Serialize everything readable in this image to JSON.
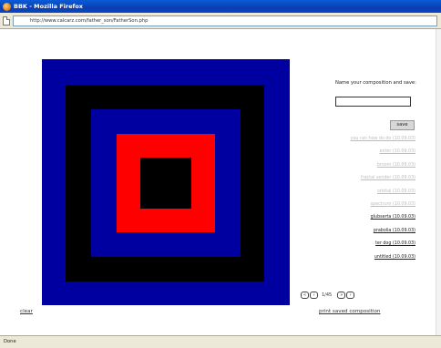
{
  "window": {
    "title": "BBK - Mozilla Firefox"
  },
  "address": {
    "url": "http://www.calcarz.com/father_son/FatherSon.php"
  },
  "side": {
    "name_label": "Name your composition and save:",
    "name_value": "",
    "save_label": "save",
    "compositions": [
      {
        "label": "you ran how do do (10.09.03)",
        "state": "faded"
      },
      {
        "label": "enter (10.09.03)",
        "state": "faded"
      },
      {
        "label": "broom (10.09.03)",
        "state": "faded"
      },
      {
        "label": "fractal sender (10.09.03)",
        "state": "faded"
      },
      {
        "label": "orbital (10.09.03)",
        "state": "faded"
      },
      {
        "label": "spectrum (10.09.03)",
        "state": "faded"
      },
      {
        "label": "glubserta (10.09.03)",
        "state": "active"
      },
      {
        "label": "prabolia (10.09.03)",
        "state": "active"
      },
      {
        "label": "ter dog (10.09.03)",
        "state": "active"
      },
      {
        "label": "untitled (10.09.03)",
        "state": "active"
      }
    ]
  },
  "pager": {
    "first": "«",
    "prev": "‹",
    "count": "1/45",
    "next": "»",
    "last": "›"
  },
  "links": {
    "clear": "clear",
    "print": "print saved composition"
  },
  "status": {
    "text": "Done"
  },
  "colors": {
    "blue": "#0000a0",
    "black": "#000000",
    "red": "#ff0000"
  }
}
